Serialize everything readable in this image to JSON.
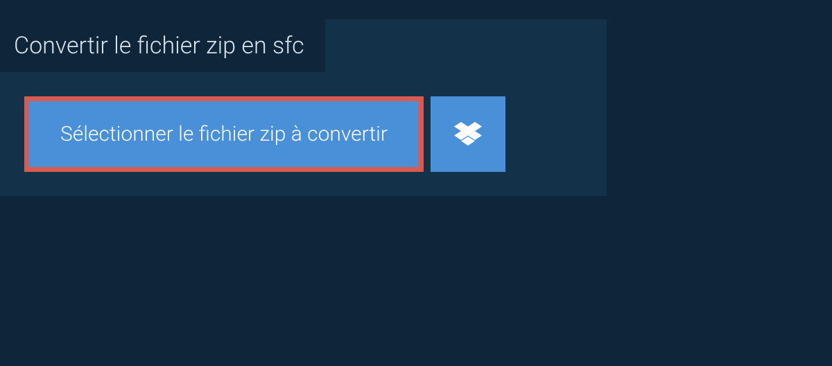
{
  "title": "Convertir le fichier zip en sfc",
  "buttons": {
    "select_label": "Sélectionner le fichier zip à convertir"
  },
  "colors": {
    "background_dark": "#0f2539",
    "background_panel": "#14314a",
    "button_blue": "#4a90d9",
    "border_red": "#d95b4f",
    "text_light": "#d8e3ec",
    "text_white": "#ffffff"
  }
}
